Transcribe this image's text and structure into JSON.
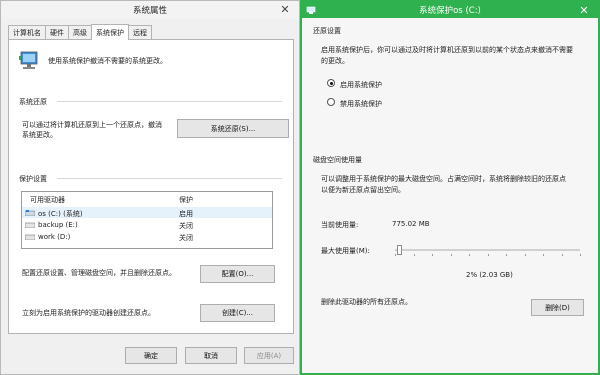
{
  "win1": {
    "title": "系统属性",
    "tabs": [
      "计算机名",
      "硬件",
      "高级",
      "系统保护",
      "远程"
    ],
    "intro": "使用系统保护撤消不需要的系统更改。",
    "restore_header": "系统还原",
    "restore_desc_line1": "可以通过将计算机还原到上一个还原点，撤消",
    "restore_desc_line2": "系统更改。",
    "restore_button": "系统还原(S)...",
    "protect_header": "保护设置",
    "col_drive": "可用驱动器",
    "col_protect": "保护",
    "drives": [
      {
        "name": "os (C:) (系统)",
        "status": "启用",
        "icon": "system-drive-icon"
      },
      {
        "name": "backup (E:)",
        "status": "关闭",
        "icon": "drive-icon"
      },
      {
        "name": "work (D:)",
        "status": "关闭",
        "icon": "drive-icon"
      }
    ],
    "config_desc": "配置还原设置、管理磁盘空间，并且删除还原点。",
    "config_button": "配置(O)...",
    "create_desc": "立刻为启用系统保护的驱动器创建还原点。",
    "create_button": "创建(C)...",
    "ok": "确定",
    "cancel": "取消",
    "apply": "应用(A)"
  },
  "win2": {
    "title": "系统保护os (C:)",
    "restore_header": "还原设置",
    "restore_desc_line1": "启用系统保护后，你可以通过及时将计算机还原到以前的某个状态点来撤消不需要",
    "restore_desc_line2": "的更改。",
    "radio_on": "启用系统保护",
    "radio_off": "禁用系统保护",
    "disk_header": "磁盘空间使用量",
    "disk_desc_line1": "可以调整用于系统保护的最大磁盘空间。占满空间时，系统将删除较旧的还原点",
    "disk_desc_line2": "以便为新还原点留出空间。",
    "current_label": "当前使用量:",
    "current_value": "775.02 MB",
    "max_label": "最大使用量(M):",
    "max_percent": 0.02,
    "max_value": "2% (2.03 GB)",
    "delete_desc": "删除此驱动器的所有还原点。",
    "delete_button": "删除(D)"
  },
  "colors": {
    "accent": "#2fb14f",
    "selection": "#e5f1fb"
  },
  "icons": {
    "close": "close-icon",
    "computer": "computer-icon"
  }
}
